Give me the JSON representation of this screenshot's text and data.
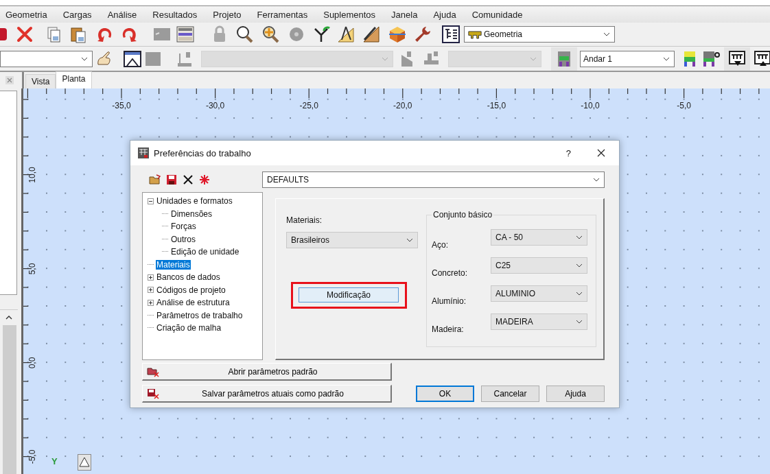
{
  "menu": [
    "Geometria",
    "Cargas",
    "Análise",
    "Resultados",
    "Projeto",
    "Ferramentas",
    "Suplementos",
    "Janela",
    "Ajuda",
    "Comunidade"
  ],
  "toolbar": {
    "layer_select": "Geometria",
    "floor_select": "Andar 1"
  },
  "tabs": [
    {
      "label": "Vista",
      "selected": false
    },
    {
      "label": "Planta",
      "selected": true
    }
  ],
  "canvas": {
    "x_labels": [
      "-35,0",
      "-30,0",
      "-25,0",
      "-20,0",
      "-15,0",
      "-10,0",
      "-5,0"
    ],
    "y_labels": [
      "10,0",
      "5,0",
      "0,0",
      "-5,0"
    ],
    "axis_label": "Y"
  },
  "dialog": {
    "title": "Preferências do trabalho",
    "help": "?",
    "preset": "DEFAULTS",
    "tree": [
      {
        "label": "Unidades e formatos",
        "expanded": true,
        "selected": false,
        "children": [
          {
            "label": "Dimensões",
            "selected": false
          },
          {
            "label": "Forças",
            "selected": false
          },
          {
            "label": "Outros",
            "selected": false
          },
          {
            "label": "Edição de unidade",
            "selected": false
          }
        ]
      },
      {
        "label": "Materiais",
        "selected": true
      },
      {
        "label": "Bancos de dados",
        "expanded": false,
        "selected": false
      },
      {
        "label": "Códigos de projeto",
        "expanded": false,
        "selected": false
      },
      {
        "label": "Análise de estrutura",
        "expanded": false,
        "selected": false
      },
      {
        "label": "Parâmetros de trabalho",
        "selected": false
      },
      {
        "label": "Criação de malha",
        "selected": false
      }
    ],
    "materials_label": "Materiais:",
    "materials_value": "Brasileiros",
    "modify_button": {
      "label": "Modificação",
      "highlighted": true
    },
    "group_title": "Conjunto básico",
    "fields": [
      {
        "label": "Aço:",
        "value": "CA - 50"
      },
      {
        "label": "Concreto:",
        "value": "C25"
      },
      {
        "label": "Alumínio:",
        "value": "ALUMINIO"
      },
      {
        "label": "Madeira:",
        "value": "MADEIRA"
      }
    ],
    "open_defaults": "Abrir parâmetros padrão",
    "save_defaults": "Salvar parâmetros atuais como padrão",
    "buttons": [
      {
        "label": "OK",
        "default": true
      },
      {
        "label": "Cancelar",
        "default": false
      },
      {
        "label": "Ajuda",
        "default": false
      }
    ]
  }
}
